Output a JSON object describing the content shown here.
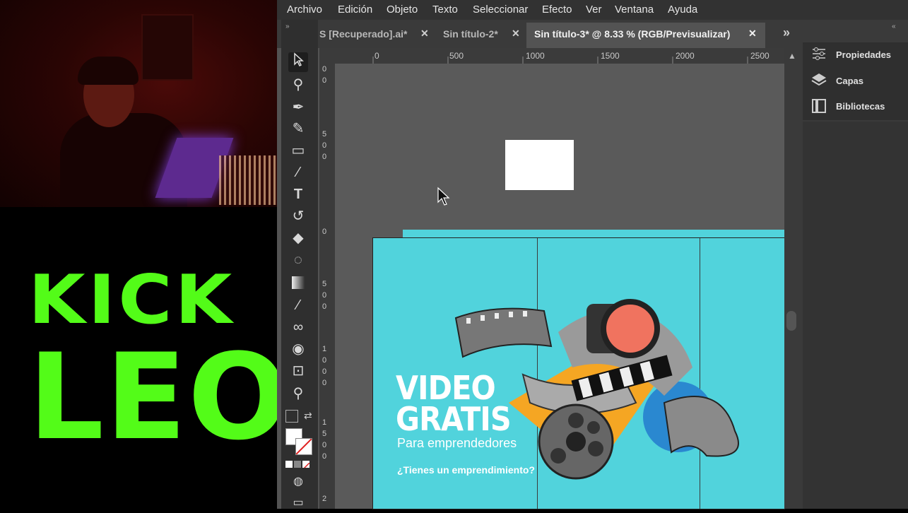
{
  "menubar": {
    "items": [
      "Archivo",
      "Edición",
      "Objeto",
      "Texto",
      "Seleccionar",
      "Efecto",
      "Ver",
      "Ventana",
      "Ayuda"
    ]
  },
  "tabs": [
    {
      "label": "S [Recuperado].ai*",
      "active": false
    },
    {
      "label": "Sin título-2*",
      "active": false
    },
    {
      "label": "Sin título-3* @ 8.33 % (RGB/Previsualizar)",
      "active": true
    }
  ],
  "tab_close_glyph": "✕",
  "tab_overflow_glyph": "»",
  "ruler": {
    "top_labels": [
      "0",
      "500",
      "1000",
      "1500",
      "2000",
      "2500"
    ],
    "left_labels": [
      [
        "0",
        "0"
      ],
      [
        "5",
        "0",
        "0"
      ],
      [
        "0"
      ],
      [
        "5",
        "0",
        "0"
      ],
      [
        "1",
        "0",
        "0",
        "0"
      ],
      [
        "1",
        "5",
        "0",
        "0"
      ],
      [
        "2"
      ]
    ]
  },
  "panel": {
    "items": [
      {
        "label": "Propiedades",
        "icon": "properties-icon"
      },
      {
        "label": "Capas",
        "icon": "layers-icon"
      },
      {
        "label": "Bibliotecas",
        "icon": "libraries-icon"
      }
    ]
  },
  "artboard": {
    "headline_line1": "VIDEO",
    "headline_line2": "GRATIS",
    "subline": "Para emprendedores",
    "question": "¿Tienes un emprendimiento?",
    "background_color": "#51d3dc"
  },
  "logo": {
    "line1": "KICK",
    "line2": "LEO",
    "color": "#53fc18"
  },
  "tools": [
    "selection-tool-icon",
    "magic-wand-icon",
    "pen-tool-icon",
    "curvature-tool-icon",
    "rectangle-tool-icon",
    "paintbrush-tool-icon",
    "type-tool-icon",
    "rotate-tool-icon",
    "eraser-tool-icon",
    "lasso-tool-icon",
    "gradient-tool-icon",
    "eyedropper-tool-icon",
    "blend-tool-icon",
    "shape-builder-icon",
    "artboard-tool-icon",
    "zoom-tool-icon"
  ]
}
